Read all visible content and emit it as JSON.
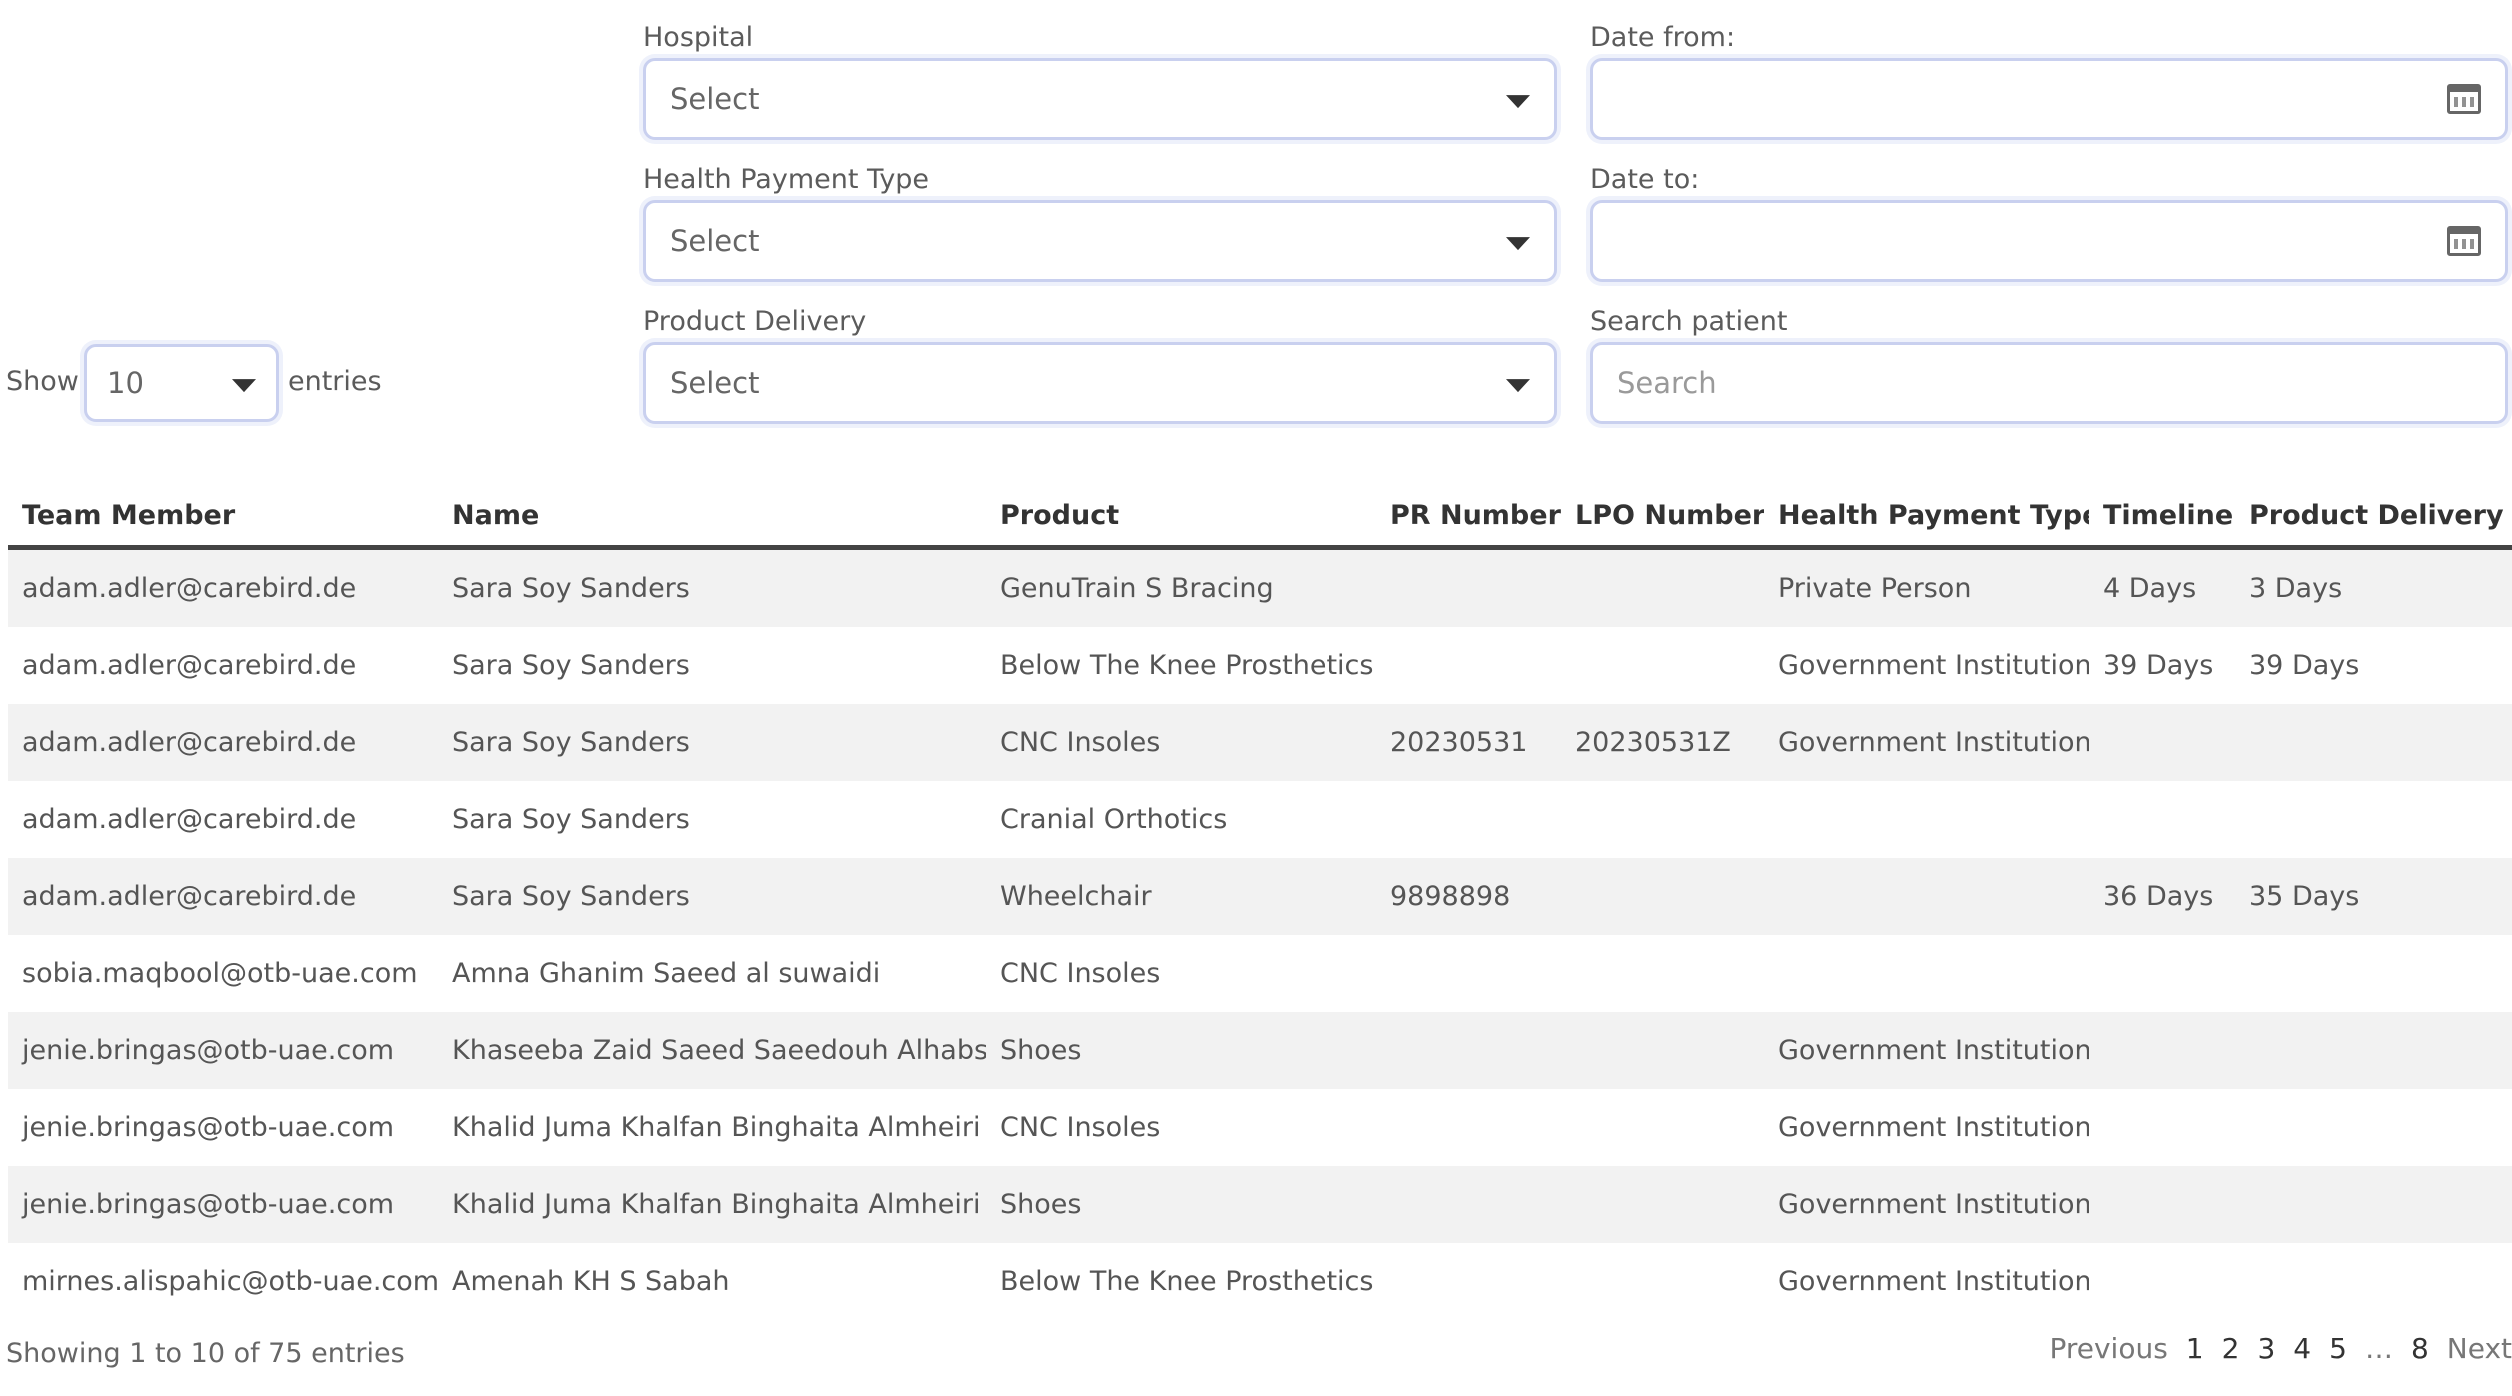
{
  "filters": {
    "hospital": {
      "label": "Hospital",
      "value": "Select"
    },
    "date_from": {
      "label": "Date from:",
      "value": ""
    },
    "health_payment_type": {
      "label": "Health Payment Type",
      "value": "Select"
    },
    "date_to": {
      "label": "Date to:",
      "value": ""
    },
    "product_delivery": {
      "label": "Product Delivery",
      "value": "Select"
    },
    "search_patient": {
      "label": "Search patient",
      "placeholder": "Search"
    }
  },
  "length": {
    "show_label": "Show",
    "value": "10",
    "entries_label": "entries"
  },
  "table": {
    "headers": [
      "Team Member",
      "Name",
      "Product",
      "PR Number",
      "LPO Number",
      "Health Payment Type",
      "Timeline",
      "Product Delivery"
    ],
    "rows": [
      [
        "adam.adler@carebird.de",
        "Sara Soy Sanders",
        "GenuTrain S Bracing",
        "",
        "",
        "Private Person",
        "4 Days",
        "3 Days"
      ],
      [
        "adam.adler@carebird.de",
        "Sara Soy Sanders",
        "Below The Knee Prosthetics",
        "",
        "",
        "Government Institution",
        "39 Days",
        "39 Days"
      ],
      [
        "adam.adler@carebird.de",
        "Sara Soy Sanders",
        "CNC Insoles",
        "20230531",
        "20230531Z",
        "Government Institution",
        "",
        ""
      ],
      [
        "adam.adler@carebird.de",
        "Sara Soy Sanders",
        "Cranial Orthotics",
        "",
        "",
        "",
        "",
        ""
      ],
      [
        "adam.adler@carebird.de",
        "Sara Soy Sanders",
        "Wheelchair",
        "9898898",
        "",
        "",
        "36 Days",
        "35 Days"
      ],
      [
        "sobia.maqbool@otb-uae.com",
        "Amna Ghanim Saeed al suwaidi",
        "CNC Insoles",
        "",
        "",
        "",
        "",
        ""
      ],
      [
        "jenie.bringas@otb-uae.com",
        "Khaseeba Zaid Saeed Saeedouh Alhabsi",
        "Shoes",
        "",
        "",
        "Government Institution",
        "",
        ""
      ],
      [
        "jenie.bringas@otb-uae.com",
        "Khalid Juma Khalfan Binghaita Almheiri",
        "CNC Insoles",
        "",
        "",
        "Government Institution",
        "",
        ""
      ],
      [
        "jenie.bringas@otb-uae.com",
        "Khalid Juma Khalfan Binghaita Almheiri",
        "Shoes",
        "",
        "",
        "Government Institution",
        "",
        ""
      ],
      [
        "mirnes.alispahic@otb-uae.com",
        "Amenah KH S Sabah",
        "Below The Knee Prosthetics",
        "",
        "",
        "Government Institution",
        "",
        ""
      ]
    ]
  },
  "footer": {
    "info": "Showing 1 to 10 of 75 entries",
    "pagination": {
      "previous": "Previous",
      "pages": [
        "1",
        "2",
        "3",
        "4",
        "5"
      ],
      "ellipsis": "…",
      "last": "8",
      "next": "Next"
    }
  }
}
